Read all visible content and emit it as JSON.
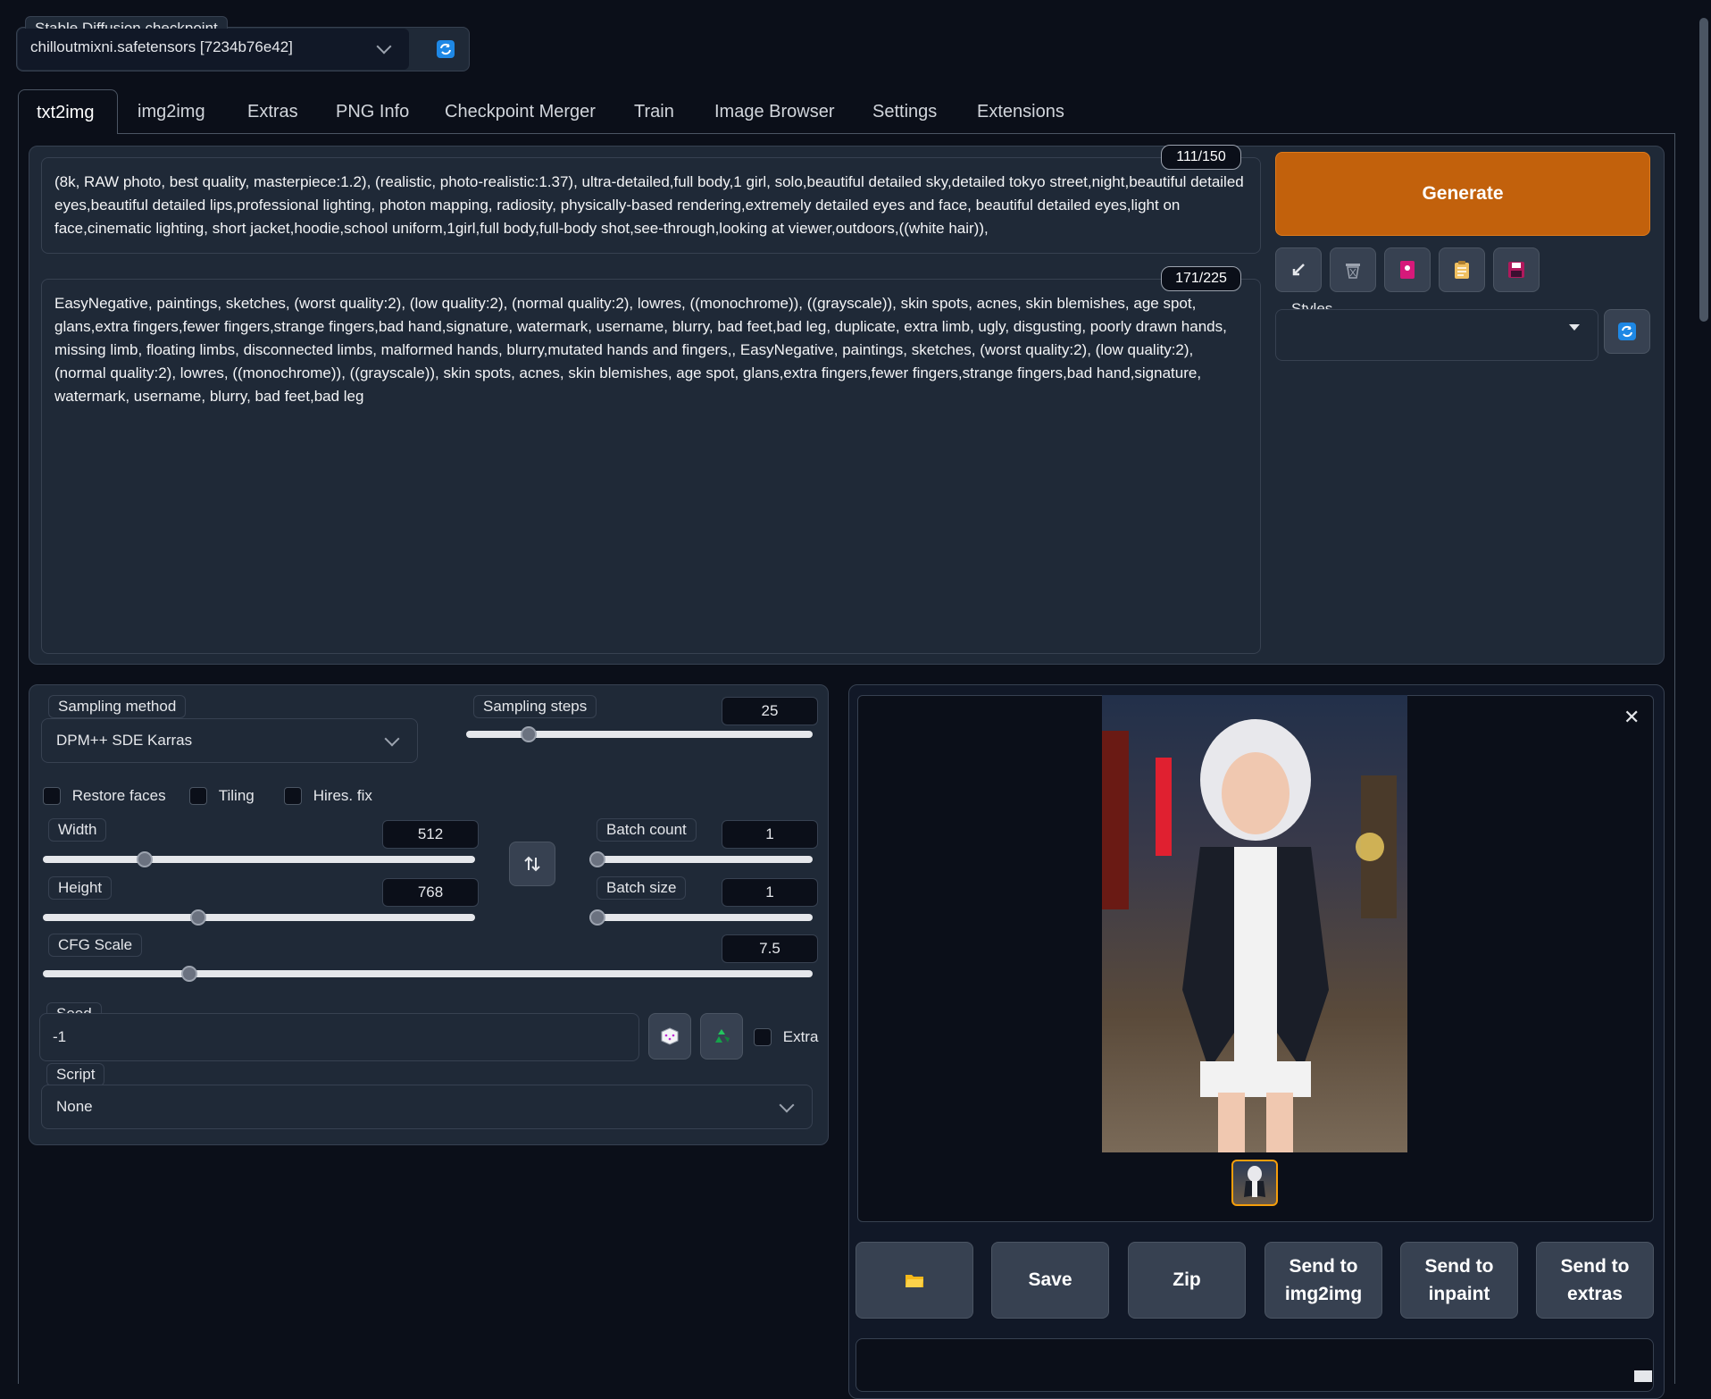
{
  "checkpoint": {
    "label": "Stable Diffusion checkpoint",
    "value": "chilloutmixni.safetensors [7234b76e42]"
  },
  "tabs": [
    {
      "label": "txt2img",
      "active": true
    },
    {
      "label": "img2img"
    },
    {
      "label": "Extras"
    },
    {
      "label": "PNG Info"
    },
    {
      "label": "Checkpoint Merger"
    },
    {
      "label": "Train"
    },
    {
      "label": "Image Browser"
    },
    {
      "label": "Settings"
    },
    {
      "label": "Extensions"
    }
  ],
  "prompt": {
    "counter": "111/150",
    "text": "(8k, RAW photo, best quality, masterpiece:1.2), (realistic, photo-realistic:1.37), ultra-detailed,full body,1 girl, solo,beautiful detailed sky,detailed tokyo street,night,beautiful detailed eyes,beautiful detailed lips,professional lighting, photon mapping, radiosity, physically-based rendering,extremely detailed eyes and face, beautiful detailed eyes,light on face,cinematic lighting, short jacket,hoodie,school uniform,1girl,full body,full-body shot,see-through,looking at viewer,outdoors,((white hair)),"
  },
  "negative_prompt": {
    "counter": "171/225",
    "text": "EasyNegative, paintings, sketches, (worst quality:2), (low quality:2), (normal quality:2), lowres, ((monochrome)), ((grayscale)), skin spots, acnes, skin blemishes, age spot, glans,extra fingers,fewer fingers,strange fingers,bad hand,signature, watermark, username, blurry, bad feet,bad leg, duplicate, extra limb, ugly, disgusting, poorly drawn hands, missing limb, floating limbs, disconnected limbs, malformed hands, blurry,mutated hands and fingers,, EasyNegative, paintings, sketches, (worst quality:2), (low quality:2), (normal quality:2), lowres, ((monochrome)), ((grayscale)), skin spots, acnes, skin blemishes, age spot, glans,extra fingers,fewer fingers,strange fingers,bad hand,signature, watermark, username, blurry, bad feet,bad leg"
  },
  "generate": {
    "label": "Generate",
    "color": "#c2610c"
  },
  "tool_icons": [
    "arrow-icon",
    "trash-icon",
    "card-icon",
    "clipboard-icon",
    "save-disk-icon"
  ],
  "styles": {
    "label": "Styles",
    "value": ""
  },
  "sampling": {
    "method_label": "Sampling method",
    "method_value": "DPM++ SDE Karras",
    "steps_label": "Sampling steps",
    "steps_value": "25",
    "steps_fraction": 0.167
  },
  "checks": {
    "restore_faces": "Restore faces",
    "tiling": "Tiling",
    "hires": "Hires. fix"
  },
  "width": {
    "label": "Width",
    "value": "512",
    "fraction": 0.235
  },
  "height": {
    "label": "Height",
    "value": "768",
    "fraction": 0.36
  },
  "batch_count": {
    "label": "Batch count",
    "value": "1",
    "fraction": 0.0
  },
  "batch_size": {
    "label": "Batch size",
    "value": "1",
    "fraction": 0.0
  },
  "cfg": {
    "label": "CFG Scale",
    "value": "7.5",
    "fraction": 0.23
  },
  "seed": {
    "label": "Seed",
    "value": "-1",
    "extra_label": "Extra"
  },
  "script": {
    "label": "Script",
    "value": "None"
  },
  "output_buttons": {
    "folder": "folder-icon",
    "save": "Save",
    "zip": "Zip",
    "send_img2img": "Send to img2img",
    "send_inpaint": "Send to inpaint",
    "send_extras": "Send to extras"
  },
  "colors": {
    "accent": "#c2610c",
    "background": "#0b0f19",
    "panel": "#1f2937"
  }
}
